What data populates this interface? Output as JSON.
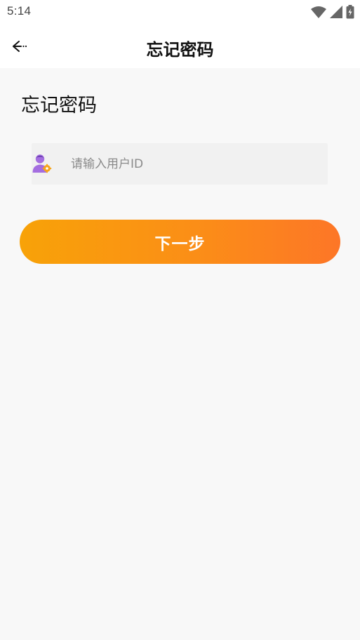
{
  "status_bar": {
    "time": "5:14",
    "icons": [
      "wifi-icon",
      "cell-signal-icon",
      "battery-charging-icon"
    ]
  },
  "app_bar": {
    "back_icon": "arrow-left-icon",
    "title": "忘记密码"
  },
  "form": {
    "heading": "忘记密码",
    "user_id_input": {
      "icon": "user-settings-icon",
      "placeholder": "请输入用户ID",
      "value": ""
    },
    "next_button_label": "下一步"
  },
  "colors": {
    "accent_start": "#f8a208",
    "accent_end": "#fd7627",
    "page_background": "#f8f8f8",
    "input_background": "#f1f1f1",
    "user_icon_purple": "#a46ee0",
    "user_icon_gear": "#f6a51c"
  }
}
